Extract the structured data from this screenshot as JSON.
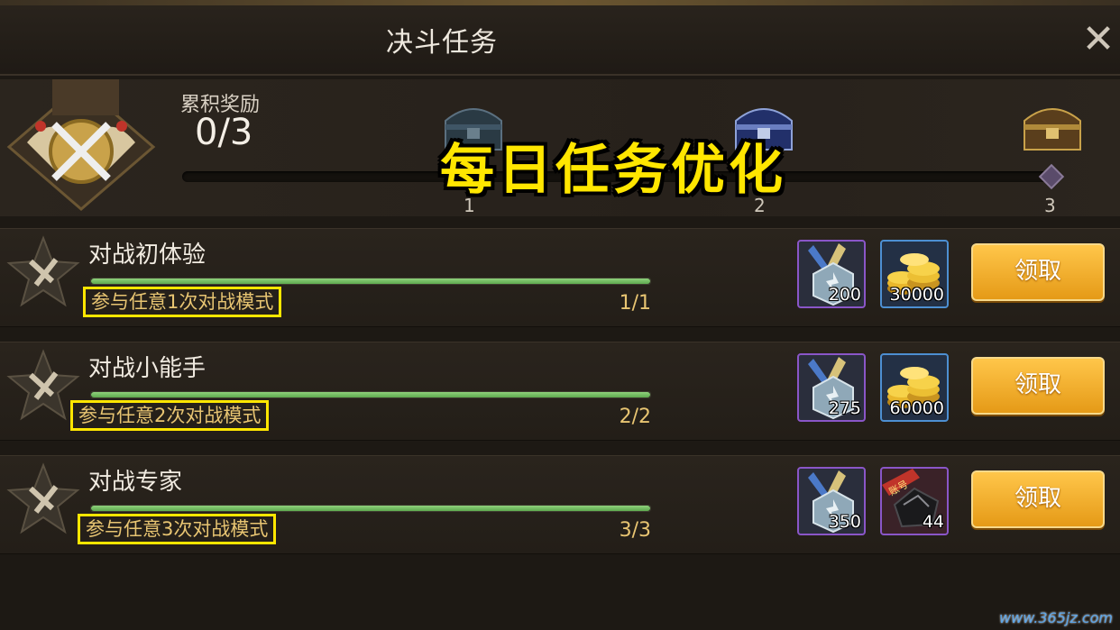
{
  "header": {
    "title": "决斗任务",
    "close_icon": "close-icon"
  },
  "cumulative": {
    "label": "累积奖励",
    "count": "0/3",
    "progress_fraction": 0,
    "milestones": [
      {
        "number": "1",
        "icon": "chest-dark-icon"
      },
      {
        "number": "2",
        "icon": "chest-blue-icon"
      },
      {
        "number": "3",
        "icon": "chest-gold-icon"
      }
    ]
  },
  "overlay_title": "每日任务优化",
  "tasks": [
    {
      "name": "对战初体验",
      "description": "参与任意1次对战模式",
      "progress": "1/1",
      "progress_fraction": 1,
      "rewards": [
        {
          "icon": "medal-badge-icon",
          "quantity": "200",
          "frame": "purple"
        },
        {
          "icon": "gold-coins-icon",
          "quantity": "30000",
          "frame": "blue"
        }
      ],
      "claim_label": "领取"
    },
    {
      "name": "对战小能手",
      "description": "参与任意2次对战模式",
      "progress": "2/2",
      "progress_fraction": 1,
      "rewards": [
        {
          "icon": "medal-badge-icon",
          "quantity": "275",
          "frame": "purple"
        },
        {
          "icon": "gold-coins-icon",
          "quantity": "60000",
          "frame": "blue"
        }
      ],
      "claim_label": "领取"
    },
    {
      "name": "对战专家",
      "description": "参与任意3次对战模式",
      "progress": "3/3",
      "progress_fraction": 1,
      "rewards": [
        {
          "icon": "medal-badge-icon",
          "quantity": "350",
          "frame": "purple"
        },
        {
          "icon": "account-item-icon",
          "quantity": "44",
          "frame": "purple",
          "tag": "账号"
        }
      ],
      "claim_label": "领取"
    }
  ],
  "watermark": "www.365jz.com",
  "colors": {
    "accent_yellow": "#ffe600",
    "claim_orange": "#f0a623",
    "progress_green": "#7cc46a"
  }
}
